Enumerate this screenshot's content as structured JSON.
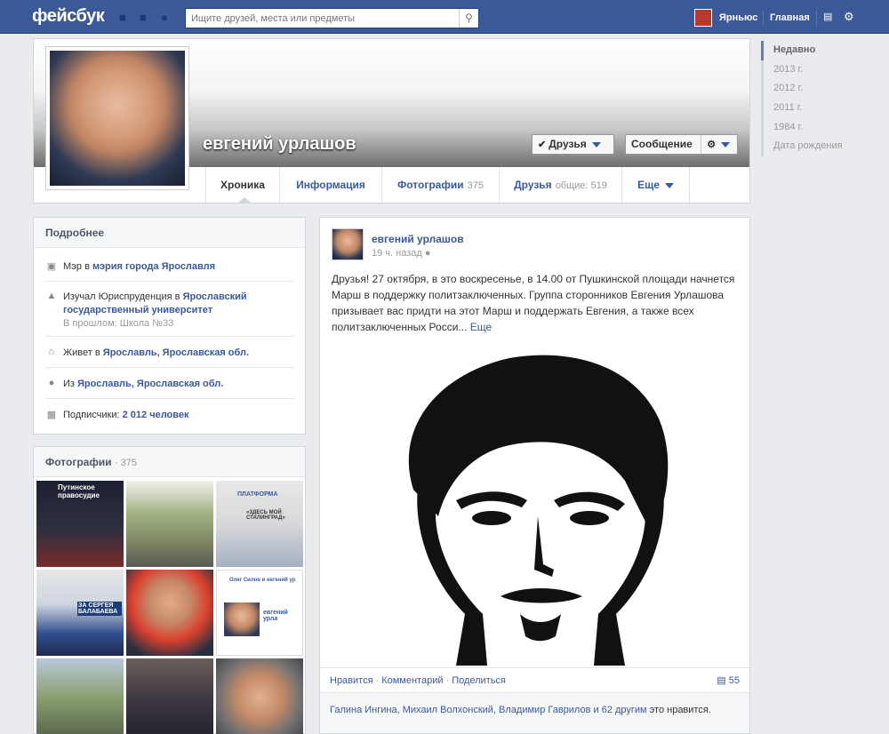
{
  "topbar": {
    "logo": "фейсбук",
    "search_placeholder": "Ищите друзей, места или предметы",
    "user_name": "Ярньюс",
    "home_label": "Главная"
  },
  "scrubber": [
    "Недавно",
    "2013 г.",
    "2012 г.",
    "2011 г.",
    "1984 г.",
    "Дата рождения"
  ],
  "profile": {
    "name": "евгений урлашов",
    "friends_button": "Друзья",
    "message_button": "Сообщение"
  },
  "tabs": {
    "timeline": "Хроника",
    "info": "Информация",
    "photos": "Фотографии",
    "photos_count": "375",
    "friends": "Друзья",
    "friends_count": "общие: 519",
    "more": "Еще"
  },
  "about": {
    "title": "Подробнее",
    "work_prefix": "Мэр в ",
    "work": "мэрия города Ярославля",
    "edu_prefix": "Изучал Юриспруденция в ",
    "edu": "Ярославский государственный университет",
    "edu_past": "В прошлом: Школа №33",
    "lives_prefix": "Живет в ",
    "lives": "Ярославль, Ярославская обл.",
    "from_prefix": "Из ",
    "from": "Ярославль, Ярославская обл.",
    "subs_prefix": "Подписчики: ",
    "subs": "2 012 человек"
  },
  "photos_box": {
    "title": "Фотографии",
    "count": "· 375",
    "thumb1_caption": "Путинское правосудие",
    "thumb3_caption": "ПЛАТФОРМА",
    "thumb3_caption2": "«ЗДЕСЬ МОЙ СТАЛИНГРАД»",
    "thumb4_caption": "ЗА СЕРГЕЯ БАЛАБАЕВА",
    "thumb6_caption": "евгений урла",
    "thumb6_caption2": "Олег Силов и евгений ур"
  },
  "post": {
    "author": "евгений урлашов",
    "time": "19 ч. назад",
    "text": "Друзья! 27 октября, в это воскресенье, в 14.00 от Пушкинской площади начнется Марш в поддержку политзаключенных. Группа сторонников Евгения Урлашова призывает вас придти на этот Марш и поддержать Евгения, а также всех политзаключенных Росси...",
    "more_link": "Еще",
    "like": "Нравится",
    "comment": "Комментарий",
    "share": "Поделиться",
    "comment_count": "55",
    "likes_names": "Галина Ингина, Михаил Волхонский, Владимир Гаврилов и 62 другим",
    "likes_suffix": "это нравится."
  }
}
